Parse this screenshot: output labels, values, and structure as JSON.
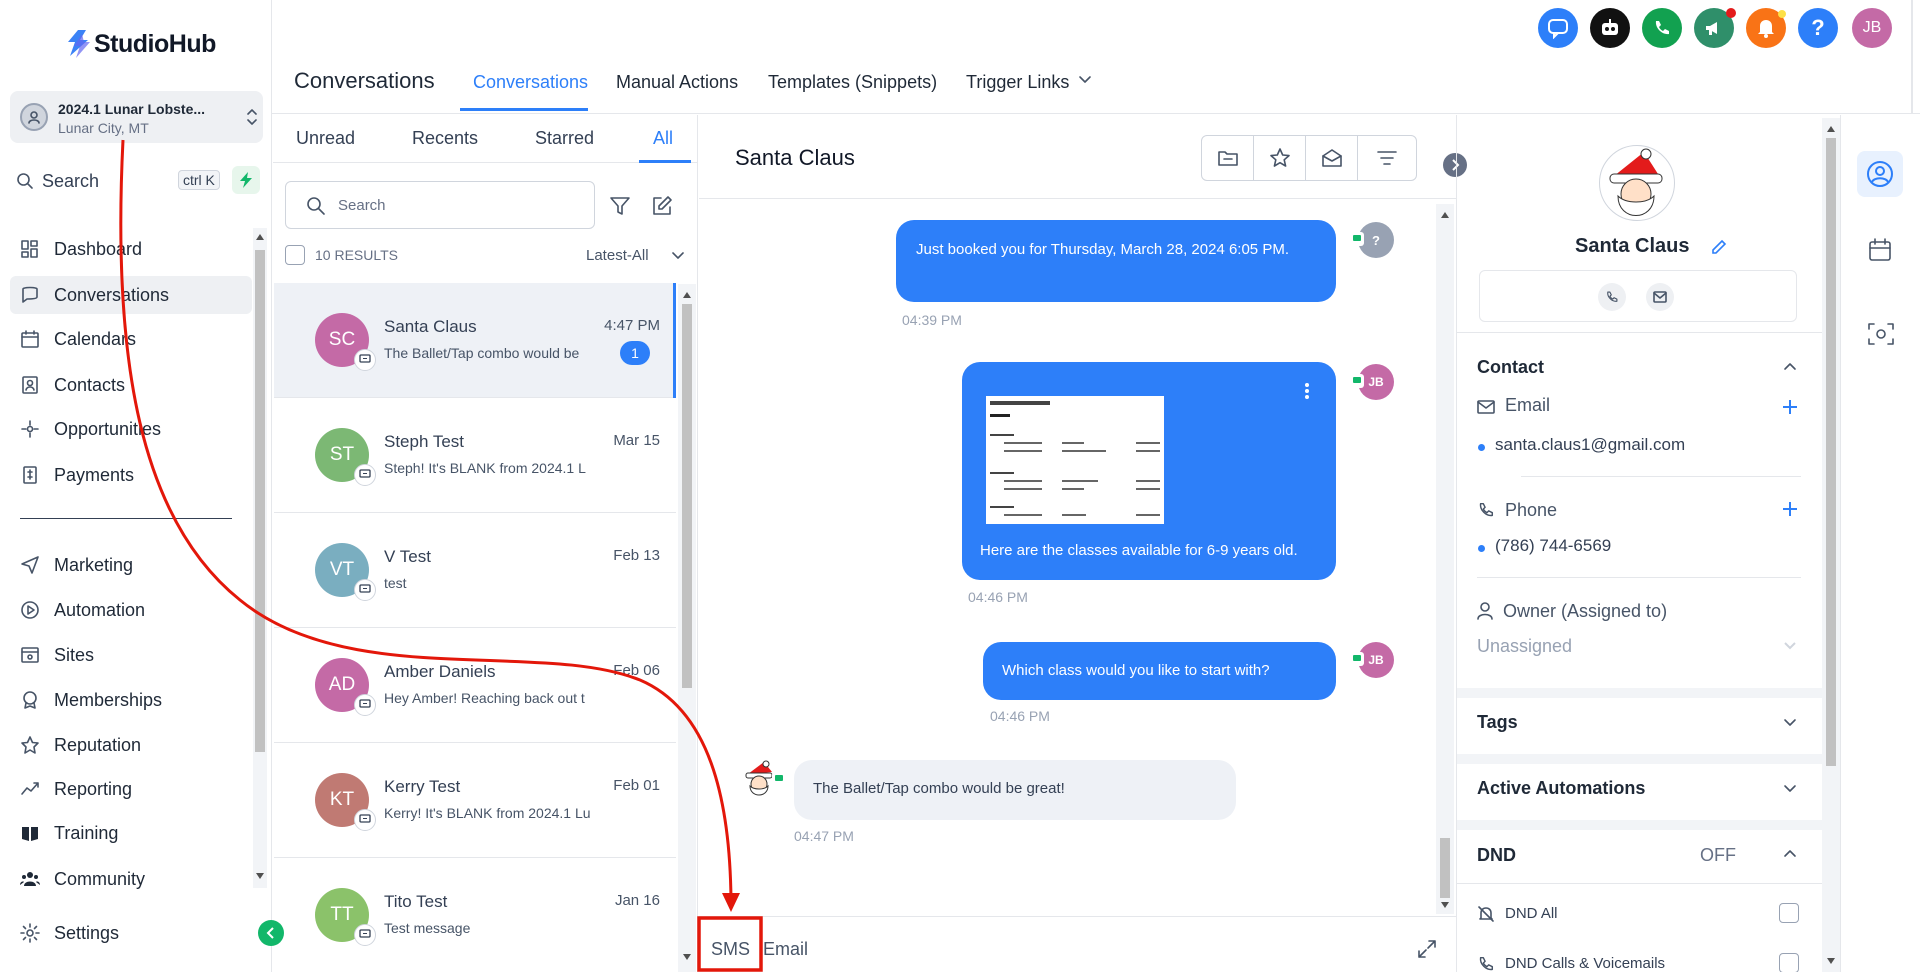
{
  "brand": {
    "name": "StudioHub"
  },
  "location": {
    "name": "2024.1 Lunar Lobste...",
    "city": "Lunar City, MT"
  },
  "search": {
    "label": "Search",
    "shortcut": "ctrl K"
  },
  "nav": {
    "items": [
      {
        "label": "Dashboard"
      },
      {
        "label": "Conversations"
      },
      {
        "label": "Calendars"
      },
      {
        "label": "Contacts"
      },
      {
        "label": "Opportunities"
      },
      {
        "label": "Payments"
      },
      {
        "label": "Marketing"
      },
      {
        "label": "Automation"
      },
      {
        "label": "Sites"
      },
      {
        "label": "Memberships"
      },
      {
        "label": "Reputation"
      },
      {
        "label": "Reporting"
      },
      {
        "label": "Training"
      },
      {
        "label": "Community"
      },
      {
        "label": "Settings"
      }
    ]
  },
  "header": {
    "title": "Conversations",
    "tabs": [
      {
        "label": "Conversations"
      },
      {
        "label": "Manual Actions"
      },
      {
        "label": "Templates (Snippets)"
      },
      {
        "label": "Trigger Links"
      }
    ],
    "user_initials": "JB",
    "help": "?"
  },
  "list": {
    "filters": [
      {
        "label": "Unread"
      },
      {
        "label": "Recents"
      },
      {
        "label": "Starred"
      },
      {
        "label": "All"
      }
    ],
    "search_placeholder": "Search",
    "results": "10 RESULTS",
    "sort": "Latest-All",
    "items": [
      {
        "initials": "SC",
        "name": "Santa Claus",
        "preview": "The Ballet/Tap combo would be",
        "date": "4:47 PM",
        "badge": "1",
        "color": "#c46aa6"
      },
      {
        "initials": "ST",
        "name": "Steph Test",
        "preview": "Steph! It's BLANK from 2024.1 L",
        "date": "Mar 15",
        "color": "#7cb874"
      },
      {
        "initials": "VT",
        "name": "V Test",
        "preview": "test",
        "date": "Feb 13",
        "color": "#7aaec0"
      },
      {
        "initials": "AD",
        "name": "Amber Daniels",
        "preview": "Hey Amber! Reaching back out t",
        "date": "Feb 06",
        "color": "#c46aa6"
      },
      {
        "initials": "KT",
        "name": "Kerry Test",
        "preview": "Kerry! It's BLANK from 2024.1 Lu",
        "date": "Feb 01",
        "color": "#c07a73"
      },
      {
        "initials": "TT",
        "name": "Tito Test",
        "preview": "Test message",
        "date": "Jan 16",
        "color": "#8bc26a"
      }
    ]
  },
  "chat": {
    "contact_name": "Santa Claus",
    "messages": [
      {
        "text": "Just booked you for Thursday, March 28, 2024 6:05 PM.",
        "time": "04:39 PM",
        "avatar": "?"
      },
      {
        "text": "Here are the classes available for 6-9 years old.",
        "time": "04:46 PM",
        "avatar": "JB"
      },
      {
        "text": "Which class would you like to start with?",
        "time": "04:46 PM",
        "avatar": "JB"
      },
      {
        "text": "The Ballet/Tap combo would be great!",
        "time": "04:47 PM"
      }
    ],
    "channels": [
      {
        "label": "SMS"
      },
      {
        "label": "Email"
      }
    ]
  },
  "contact": {
    "name": "Santa Claus",
    "section_contact": "Contact",
    "email_label": "Email",
    "email": "santa.claus1@gmail.com",
    "phone_label": "Phone",
    "phone": "(786) 744-6569",
    "owner_label": "Owner (Assigned to)",
    "owner": "Unassigned",
    "tags": "Tags",
    "automations": "Active Automations",
    "dnd": "DND",
    "dnd_state": "OFF",
    "dnd_all": "DND All",
    "dnd_calls": "DND Calls & Voicemails"
  },
  "colors": {
    "accent": "#2d7ff9",
    "annotation": "#e3170a"
  }
}
